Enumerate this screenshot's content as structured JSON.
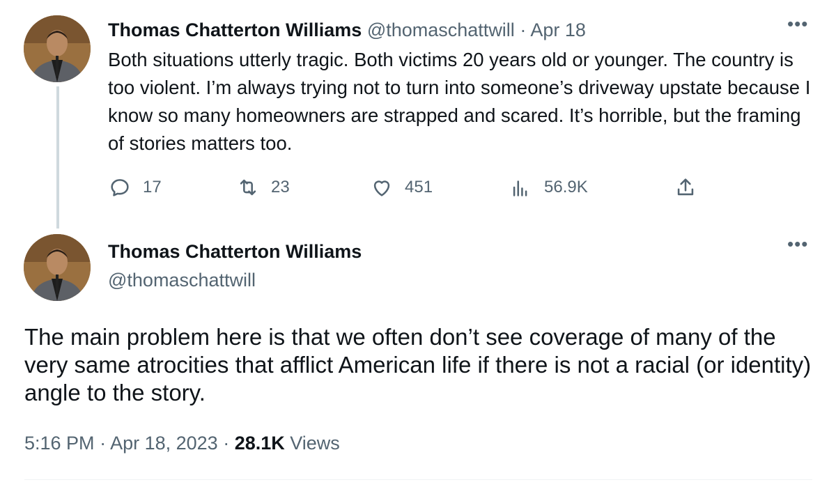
{
  "tweet1": {
    "name": "Thomas Chatterton Williams",
    "handle": "@thomaschattwill",
    "separator": " · ",
    "date": "Apr 18",
    "text": "Both situations utterly tragic. Both victims 20 years old or younger. The country is too violent. I’m always trying not to turn into someone’s driveway upstate because I know so many homeowners are strapped and scared. It’s horrible, but the framing of stories matters too.",
    "more": "•••",
    "actions": {
      "replies": "17",
      "retweets": "23",
      "likes": "451",
      "views": "56.9K"
    },
    "icons": [
      "reply-icon",
      "retweet-icon",
      "like-icon",
      "views-icon",
      "share-icon"
    ]
  },
  "tweet2": {
    "name": "Thomas Chatterton Williams",
    "handle": "@thomaschattwill",
    "more": "•••",
    "text": "The main problem here is that we often don’t see coverage of many of the very same atrocities that afflict American life if there is not a racial (or identity) angle to the story.",
    "time": "5:16 PM",
    "sep1": " · ",
    "date": "Apr 18, 2023",
    "sep2": " · ",
    "views_count": "28.1K",
    "views_label": " Views"
  },
  "colors": {
    "text": "#0f1419",
    "muted": "#536471",
    "thread_line": "#cfd9de",
    "divider": "#eff3f4"
  }
}
